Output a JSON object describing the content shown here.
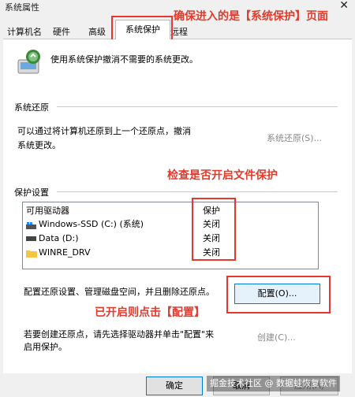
{
  "window": {
    "title": "系统属性",
    "close_glyph": "✕"
  },
  "tabs": [
    {
      "label": "计算机名"
    },
    {
      "label": "硬件"
    },
    {
      "label": "高级"
    },
    {
      "label": "系统保护",
      "active": true
    },
    {
      "label": "远程"
    }
  ],
  "annotations": {
    "top": "确保进入的是【系统保护】页面",
    "middle": "检查是否开启文件保护",
    "bottom": "已开启则点击【配置】"
  },
  "intro": {
    "text": "使用系统保护撤消不需要的系统更改。"
  },
  "restore": {
    "heading": "系统还原",
    "description_line1": "可以通过将计算机还原到上一个还原点，撤消",
    "description_line2": "系统更改。",
    "button": "系统还原(S)..."
  },
  "protection": {
    "heading": "保护设置",
    "col_drive": "可用驱动器",
    "col_status": "保护",
    "drives": [
      {
        "name": "Windows-SSD (C:) (系统)",
        "status": "关闭",
        "icon": "windows-drive-icon"
      },
      {
        "name": "Data (D:)",
        "status": "关闭",
        "icon": "drive-icon"
      },
      {
        "name": "WINRE_DRV",
        "status": "关闭",
        "icon": "folder-icon"
      }
    ]
  },
  "configure": {
    "text": "配置还原设置、管理磁盘空间，并且删除还原点。",
    "button": "配置(O)..."
  },
  "create": {
    "line1": "若要创建还原点，请先选择驱动器并单击\"配置\"来",
    "line2": "启用保护。",
    "button": "创建(C)..."
  },
  "footer": {
    "ok": "确定",
    "cancel": "取消",
    "apply": "应用(A)"
  },
  "watermark": "掘金技术社区 @ 数据蛙恢复软件",
  "colors": {
    "annotation": "#e03b2c",
    "accent": "#0078d7"
  }
}
